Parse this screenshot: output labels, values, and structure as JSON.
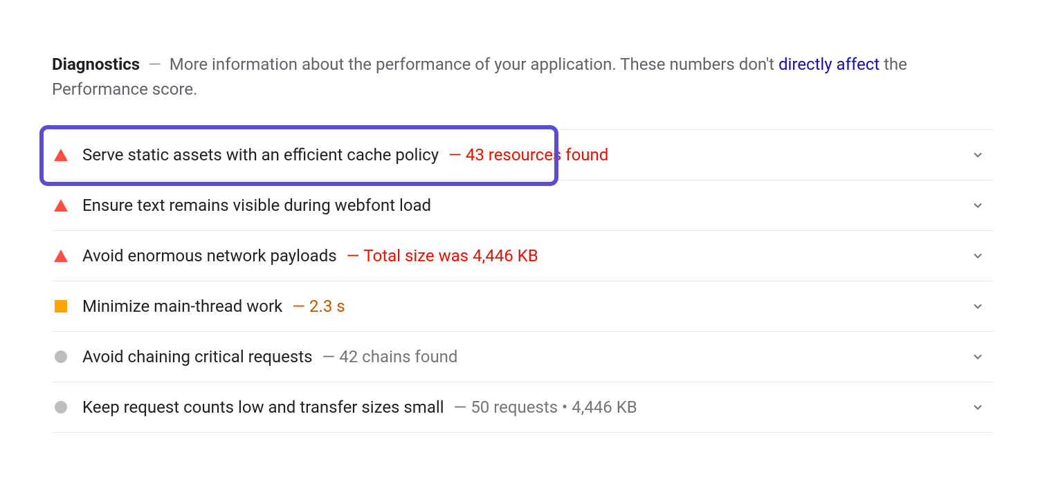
{
  "header": {
    "title": "Diagnostics",
    "dash": "—",
    "description_part1": "More information about the performance of your application. These numbers don't ",
    "link_text": "directly affect",
    "description_part2": " the Performance score."
  },
  "audits": [
    {
      "severity": "red",
      "title": "Serve static assets with an efficient cache policy",
      "detail": "43 resources found",
      "detail_color": "red",
      "highlighted": true
    },
    {
      "severity": "red",
      "title": "Ensure text remains visible during webfont load",
      "detail": "",
      "detail_color": "",
      "highlighted": false
    },
    {
      "severity": "red",
      "title": "Avoid enormous network payloads",
      "detail": "Total size was 4,446 KB",
      "detail_color": "red",
      "highlighted": false
    },
    {
      "severity": "orange",
      "title": "Minimize main-thread work",
      "detail": "2.3 s",
      "detail_color": "orange",
      "highlighted": false
    },
    {
      "severity": "gray",
      "title": "Avoid chaining critical requests",
      "detail": "42 chains found",
      "detail_color": "gray",
      "highlighted": false
    },
    {
      "severity": "gray",
      "title": "Keep request counts low and transfer sizes small",
      "detail": "50 requests • 4,446 KB",
      "detail_color": "gray",
      "highlighted": false
    }
  ],
  "dash_label": "—"
}
